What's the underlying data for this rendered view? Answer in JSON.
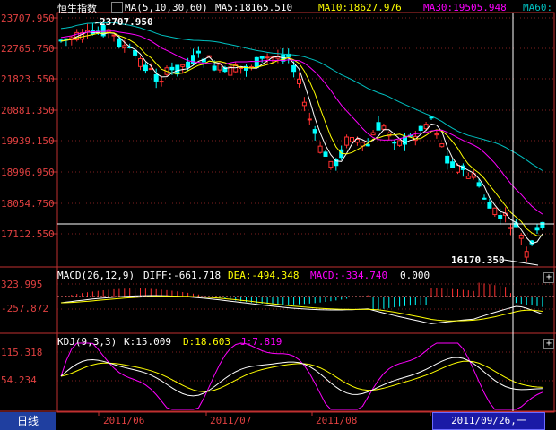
{
  "header": {
    "index_name": "恒生指数",
    "ma_label": "MA(5,10,30,60)",
    "ma5": "MA5:18165.510",
    "ma10": "MA10:18627.976",
    "ma30": "MA30:19505.948",
    "ma60": "MA60:"
  },
  "price_axis": [
    "23707.950",
    "22765.750",
    "21823.550",
    "20881.350",
    "19939.150",
    "18996.950",
    "18054.750",
    "17112.550"
  ],
  "annotations": {
    "high": "23707.950",
    "low": "16170.350"
  },
  "macd": {
    "label": "MACD(26,12,9)",
    "diff": "DIFF:-661.718",
    "dea": "DEA:-494.348",
    "macd": "MACD:-334.740",
    "zero": "0.000",
    "axis": [
      "323.995",
      "-257.872"
    ]
  },
  "kdj": {
    "label": "KDJ(9,3,3)",
    "k": "K:15.009",
    "d": "D:18.603",
    "j": "J:7.819",
    "axis": [
      "115.318",
      "54.234"
    ]
  },
  "x_axis": [
    "2011/06",
    "2011/07",
    "2011/08"
  ],
  "period_tab": "日线",
  "cursor_date": "2011/09/26,一",
  "colors": {
    "up": "#ff3030",
    "down": "#00ffff",
    "ma5": "#ffffff",
    "ma10": "#ffff00",
    "ma30": "#ff00ff",
    "ma60": "#00c0c0",
    "axis_text": "#e04040"
  }
}
